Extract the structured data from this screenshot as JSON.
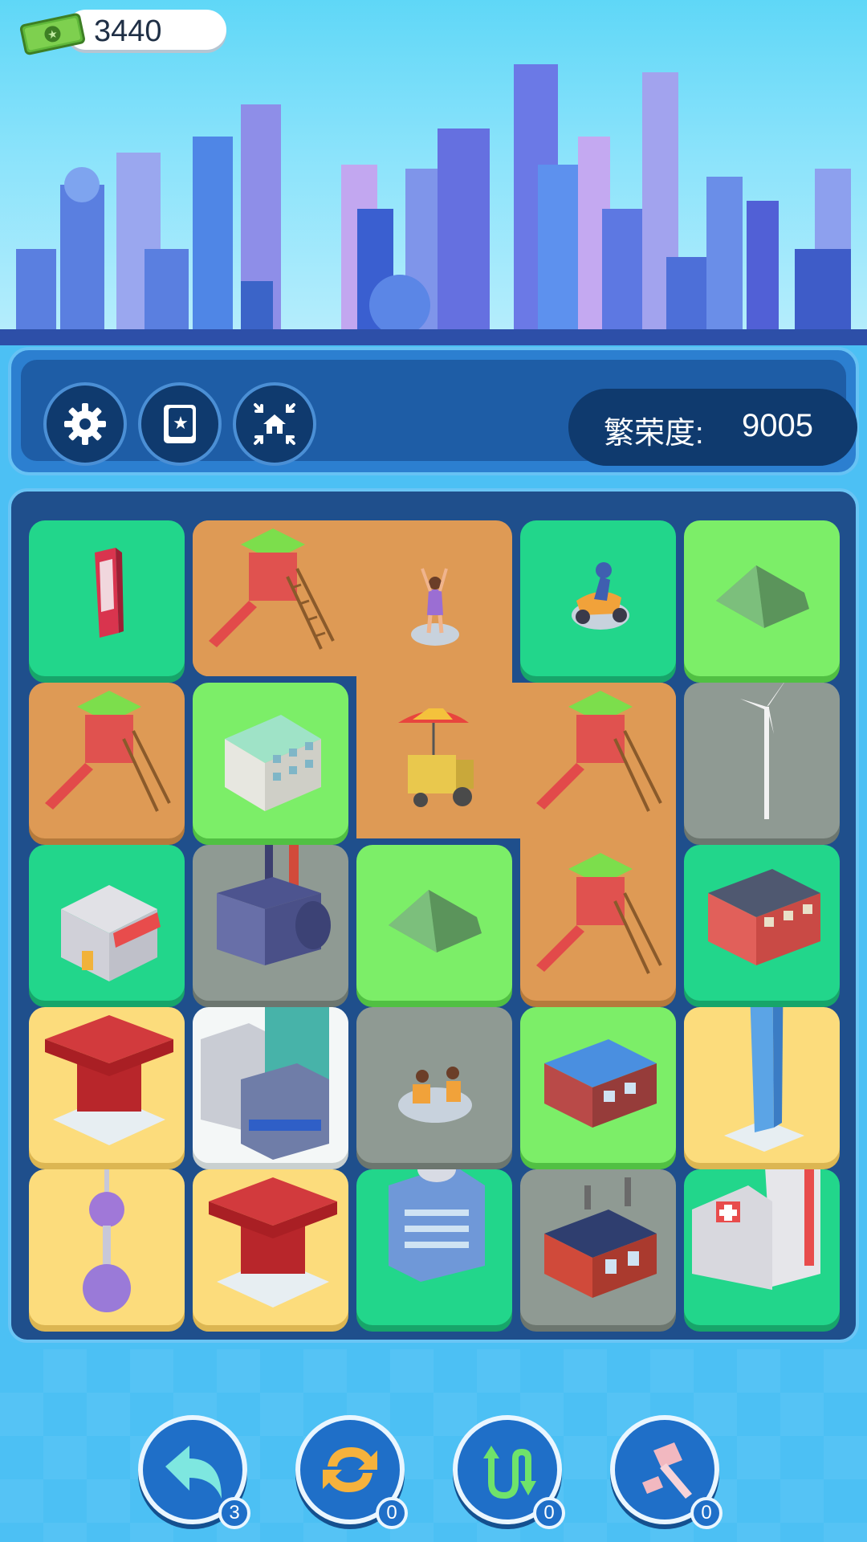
{
  "currency": {
    "amount": "3440",
    "icon": "cash-icon"
  },
  "header": {
    "prosperity_label": "繁荣度:",
    "prosperity_value": "9005"
  },
  "toolbar": {
    "buttons": [
      {
        "name": "settings-button",
        "icon": "gear-icon"
      },
      {
        "name": "collection-book-button",
        "icon": "star-book-icon"
      },
      {
        "name": "gather-houses-button",
        "icon": "collapse-house-icon"
      }
    ]
  },
  "board": {
    "rows": 5,
    "cols": 5,
    "tiles": [
      [
        "phone-booth",
        "playground-slide",
        "dancer",
        "scooter-rider",
        "tent"
      ],
      [
        "playground-slide",
        "school-building",
        "food-cart",
        "playground-slide",
        "wind-turbine"
      ],
      [
        "shop",
        "factory",
        "tent",
        "playground-slide",
        "apartment"
      ],
      [
        "china-pavilion",
        "office-complex",
        "people-meeting",
        "warehouse",
        "skyscraper"
      ],
      [
        "tv-tower",
        "china-pavilion",
        "broadcast-center",
        "red-factory",
        "hospital"
      ]
    ]
  },
  "actions": [
    {
      "name": "undo-button",
      "icon": "undo-arrow-icon",
      "count": "3"
    },
    {
      "name": "refresh-button",
      "icon": "refresh-icon",
      "count": "0"
    },
    {
      "name": "swap-button",
      "icon": "swap-arrows-icon",
      "count": "0"
    },
    {
      "name": "hammer-button",
      "icon": "hammer-icon",
      "count": "0"
    }
  ],
  "colors": {
    "green": "#22d68b",
    "lime": "#7cee68",
    "gray": "#8f9a93",
    "yellow": "#fcdc7c",
    "sand": "#de9a55",
    "board": "#1f4f8c"
  }
}
